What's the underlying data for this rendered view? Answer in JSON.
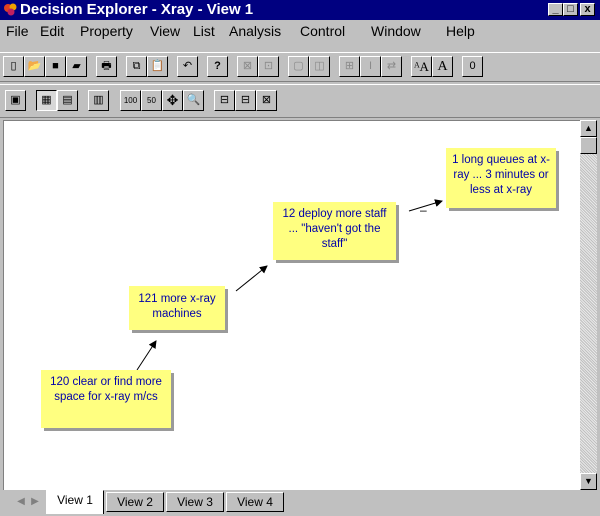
{
  "window": {
    "title": "Decision Explorer - Xray - View 1",
    "minimize": "_",
    "maximize": "□",
    "close": "x"
  },
  "menu": [
    "File",
    "Edit",
    "Property",
    "View",
    "List",
    "Analysis",
    "Control",
    "Window",
    "Help"
  ],
  "toolbar1": [
    {
      "icon": "new-file-icon",
      "glyph": "▯"
    },
    {
      "icon": "open-folder-icon",
      "glyph": "📂"
    },
    {
      "icon": "save-icon",
      "glyph": "■"
    },
    {
      "icon": "save-as-icon",
      "glyph": "▰"
    },
    {
      "icon": "print-icon",
      "glyph": "🖶"
    },
    {
      "icon": "copy-icon",
      "glyph": "⧉"
    },
    {
      "icon": "paste-icon",
      "glyph": "📋"
    },
    {
      "icon": "undo-icon",
      "glyph": "↶"
    },
    {
      "icon": "help-icon",
      "glyph": "?"
    },
    {
      "icon": "align-icon",
      "glyph": "⊠"
    },
    {
      "icon": "distribute-icon",
      "glyph": "⊡"
    },
    {
      "icon": "group-icon",
      "glyph": "▢"
    },
    {
      "icon": "ungroup-icon",
      "glyph": "◫"
    },
    {
      "icon": "table-icon",
      "glyph": "⊞"
    },
    {
      "icon": "text-cursor-icon",
      "glyph": "I"
    },
    {
      "icon": "link-style-icon",
      "glyph": "⇄"
    },
    {
      "icon": "font-large-icon",
      "glyph": "ᴬA"
    },
    {
      "icon": "font-icon",
      "glyph": "A"
    },
    {
      "icon": "zero-icon",
      "glyph": "0"
    }
  ],
  "toolbar2": [
    {
      "icon": "map-view-icon",
      "glyph": "▣"
    },
    {
      "icon": "concept-view-icon",
      "glyph": "▦"
    },
    {
      "icon": "list-view-icon",
      "glyph": "▤"
    },
    {
      "icon": "style-icon",
      "glyph": "▥"
    },
    {
      "icon": "zoom-100-icon",
      "glyph": "100"
    },
    {
      "icon": "zoom-50-icon",
      "glyph": "50"
    },
    {
      "icon": "pan-icon",
      "glyph": "✥"
    },
    {
      "icon": "zoom-icon",
      "glyph": "🔍"
    },
    {
      "icon": "layout-left-icon",
      "glyph": "⊟"
    },
    {
      "icon": "layout-right-icon",
      "glyph": "⊟"
    },
    {
      "icon": "layout-expand-icon",
      "glyph": "⊠"
    }
  ],
  "concepts": [
    {
      "id": "c1",
      "text": "1 long queues at x-ray ... 3 minutes or less at x-ray"
    },
    {
      "id": "c12",
      "text": "12 deploy more staff ... \"haven't got the staff\""
    },
    {
      "id": "c121",
      "text": "121 more x-ray machines"
    },
    {
      "id": "c120",
      "text": "120 clear or find more space for x-ray m/cs"
    }
  ],
  "link_sign": "–",
  "tabs": [
    "View 1",
    "View 2",
    "View 3",
    "View 4"
  ],
  "colors": {
    "titlebar": "#000080",
    "concept_fill": "#ffff80",
    "concept_text": "#0000aa"
  }
}
